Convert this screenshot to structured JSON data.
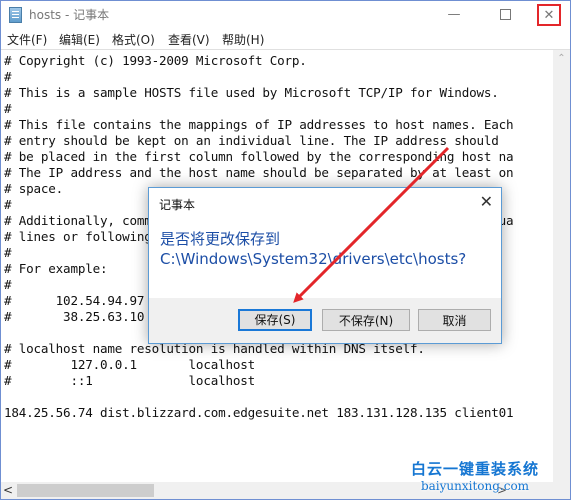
{
  "window": {
    "title": "hosts - 记事本",
    "icon": "notepad-icon",
    "controls": {
      "minimize": "—",
      "maximize": "maximize-icon",
      "close": "✕"
    }
  },
  "menubar": {
    "items": [
      {
        "label": "文件(F)"
      },
      {
        "label": "编辑(E)"
      },
      {
        "label": "格式(O)"
      },
      {
        "label": "查看(V)"
      },
      {
        "label": "帮助(H)"
      }
    ]
  },
  "editor": {
    "lines": [
      "# Copyright (c) 1993-2009 Microsoft Corp.",
      "#",
      "# This is a sample HOSTS file used by Microsoft TCP/IP for Windows.",
      "#",
      "# This file contains the mappings of IP addresses to host names. Each",
      "# entry should be kept on an individual line. The IP address should",
      "# be placed in the first column followed by the corresponding host na",
      "# The IP address and the host name should be separated by at least on",
      "# space.",
      "#",
      "# Additionally, comments (such as these) may be inserted on individua",
      "# lines or following the machine name denoted by a '#' symbol.",
      "#",
      "# For example:",
      "#",
      "#      102.54.94.97     rhino.acme.com          # source server",
      "#       38.25.63.10     x.acme.com              # x client host",
      "",
      "# localhost name resolution is handled within DNS itself.",
      "#\t127.0.0.1       localhost",
      "#\t::1             localhost",
      "",
      "184.25.56.74 dist.blizzard.com.edgesuite.net 183.131.128.135 client01"
    ]
  },
  "scrollbars": {
    "up_arrow": "⌃",
    "left_arrow": "<",
    "right_arrow": ">"
  },
  "dialog": {
    "title": "记事本",
    "close": "✕",
    "message_line1": "是否将更改保存到",
    "message_line2": "C:\\Windows\\System32\\drivers\\etc\\hosts?",
    "buttons": {
      "save": "保存(S)",
      "dont_save": "不保存(N)",
      "cancel": "取消"
    }
  },
  "watermark": {
    "brand": "白云一键重装系统",
    "url": "baiyunxitong.com"
  },
  "colors": {
    "dialog_message": "#1c4ea6",
    "primary_button_border": "#1a78d7",
    "annotation_red": "#e3262a",
    "watermark": "#1576d2"
  }
}
